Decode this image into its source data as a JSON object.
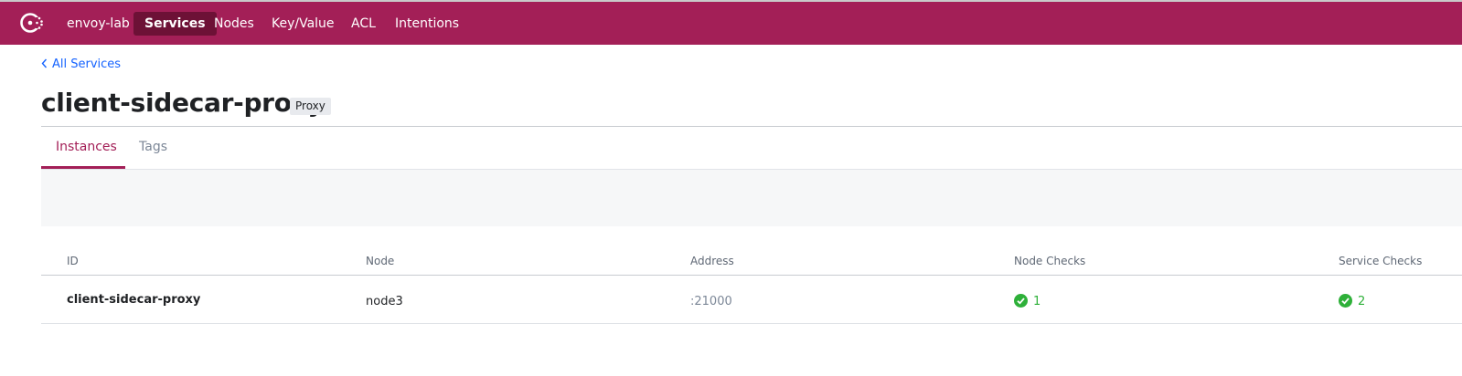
{
  "nav": {
    "datacenter": "envoy-lab",
    "items": [
      {
        "label": "Services",
        "active": true
      },
      {
        "label": "Nodes"
      },
      {
        "label": "Key/Value"
      },
      {
        "label": "ACL"
      },
      {
        "label": "Intentions"
      }
    ],
    "logo_icon": "consul-logo-icon"
  },
  "breadcrumb": {
    "label": "All Services",
    "icon": "chevron-left-icon"
  },
  "service": {
    "name": "client-sidecar-proxy",
    "kind": "Proxy"
  },
  "tabs": [
    {
      "label": "Instances",
      "active": true
    },
    {
      "label": "Tags"
    }
  ],
  "table": {
    "columns": [
      "ID",
      "Node",
      "Address",
      "Node Checks",
      "Service Checks"
    ],
    "rows": [
      {
        "id": "client-sidecar-proxy",
        "node": "node3",
        "address": ":21000",
        "node_checks": "1",
        "service_checks": "2"
      }
    ]
  },
  "colors": {
    "brand": "#a31f57",
    "nav_active_bg": "#6d1136",
    "link": "#1563ff",
    "passing": "#2eb039"
  }
}
